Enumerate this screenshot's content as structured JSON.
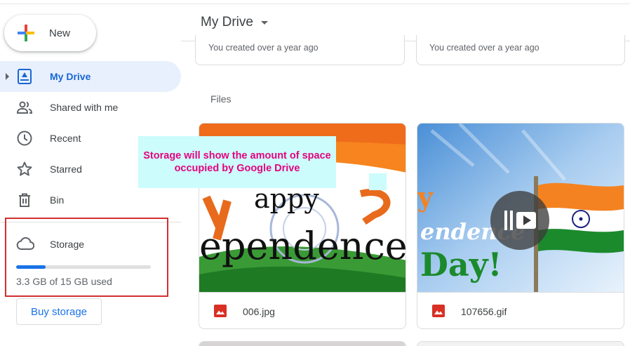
{
  "new_button": {
    "label": "New"
  },
  "sidebar": {
    "items": [
      {
        "label": "My Drive",
        "icon": "my-drive-icon",
        "active": true
      },
      {
        "label": "Shared with me",
        "icon": "shared-people-icon"
      },
      {
        "label": "Recent",
        "icon": "clock-icon"
      },
      {
        "label": "Starred",
        "icon": "star-icon"
      },
      {
        "label": "Bin",
        "icon": "trash-icon"
      }
    ]
  },
  "storage": {
    "label": "Storage",
    "icon": "cloud-icon",
    "used_text": "3.3 GB of 15 GB used",
    "used_fraction": 0.22,
    "buy_label": "Buy storage"
  },
  "header": {
    "title": "My Drive"
  },
  "folders": [
    {
      "subtitle": "You created over a year ago"
    },
    {
      "subtitle": "You created over a year ago"
    }
  ],
  "files_section": {
    "label": "Files"
  },
  "files": [
    {
      "name": "006.jpg",
      "thumb_text_top": "appy",
      "thumb_text_bottom": "ependence",
      "icon": "image-file-icon"
    },
    {
      "name": "107656.gif",
      "thumb_text_top": "y",
      "thumb_text_mid": "endence",
      "thumb_text_bottom": "Day!",
      "icon": "image-file-icon"
    }
  ],
  "annotation": {
    "text": "Storage will show the amount of space occupied by Google Drive"
  },
  "colors": {
    "accent": "#1a73e8",
    "active_bg": "#e8f0fe",
    "highlight_box": "#d32f2f",
    "annotation_bg": "#ccfcfc",
    "annotation_text": "#e6007e"
  }
}
